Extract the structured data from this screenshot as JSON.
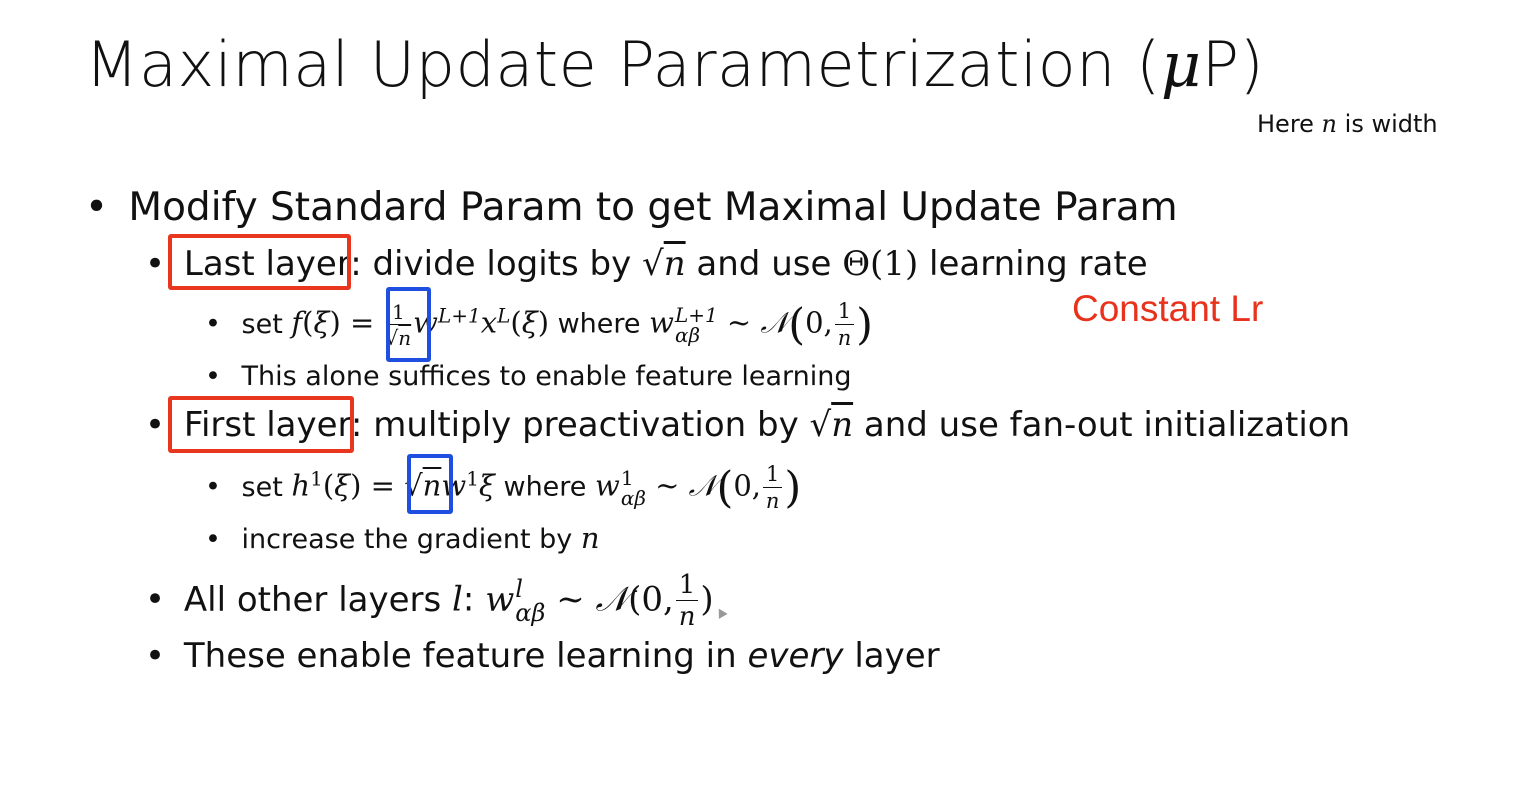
{
  "slide": {
    "title": "Maximal Update Parametrization (",
    "title_mu": "μ",
    "title_end": "P)",
    "note_prefix": "Here ",
    "note_var": "n",
    "note_suffix": " is width",
    "bullet_glyph": "•",
    "bullets": [
      {
        "text": "Modify Standard Param to get Maximal Update Param",
        "children": [
          {
            "label": "Last layer:",
            "text_before": " divide logits by ",
            "text_mid": " and use ",
            "theta": "Θ(1)",
            "text_after": " learning rate",
            "children": [
              {
                "prefix": "set ",
                "where": " where "
              },
              {
                "text": "This alone suffices to enable feature learning"
              }
            ]
          },
          {
            "label": "First layer:",
            "text_before": " multiply preactivation by ",
            "text_after": " and use fan-out initialization",
            "children": [
              {
                "prefix": "set ",
                "where": " where "
              },
              {
                "prefix": "increase the gradient by ",
                "var": "n"
              }
            ]
          },
          {
            "text_before": "All other layers ",
            "var": "l",
            "text_after": ": "
          },
          {
            "text_before": "These enable feature learning in ",
            "emph": "every",
            "text_after": " layer"
          }
        ]
      }
    ],
    "annotation": "Constant Lr",
    "colors": {
      "red_box": "#e8361f",
      "blue_box": "#1f4fe0",
      "annotation": "#e8321c"
    }
  }
}
